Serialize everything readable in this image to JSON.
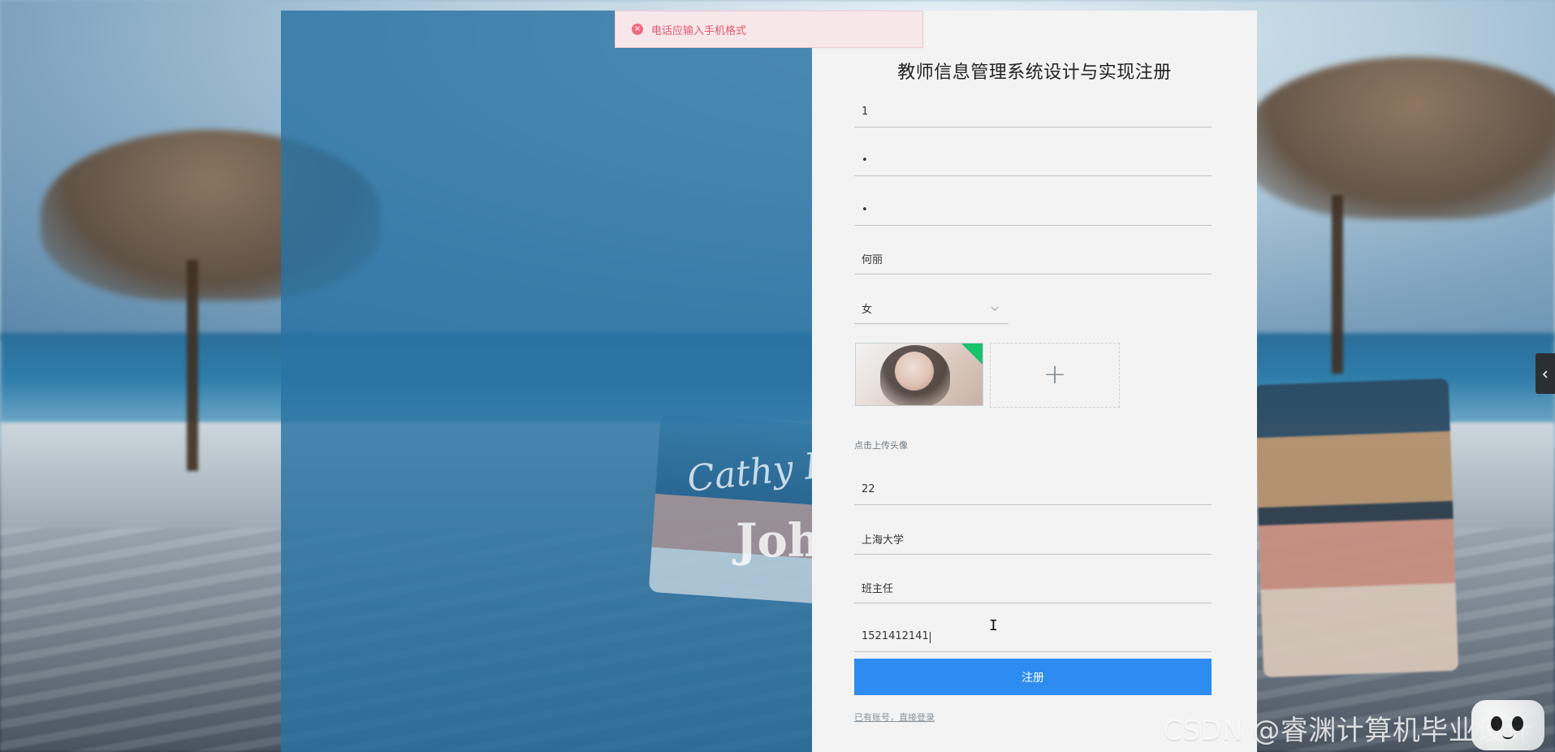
{
  "toast": {
    "message": "电话应输入手机格式"
  },
  "register": {
    "title": "教师信息管理系统设计与实现注册",
    "fields": [
      {
        "name": "account",
        "value": "1"
      },
      {
        "name": "password",
        "value": "•"
      },
      {
        "name": "confirm-password",
        "value": "•"
      },
      {
        "name": "name",
        "value": "何丽"
      },
      {
        "name": "age",
        "value": "22"
      },
      {
        "name": "school",
        "value": "上海大学"
      },
      {
        "name": "position",
        "value": "班主任"
      },
      {
        "name": "phone",
        "value": "1521412141"
      }
    ],
    "gender": {
      "selected": "女"
    },
    "upload": {
      "hint": "点击上传头像"
    },
    "submit_label": "注册",
    "login_link": "已有账号，直接登录"
  },
  "watermark": "CSDN @睿渊计算机毕业设计",
  "icons": {
    "toast_icon": "error-circle-icon",
    "chevron": "chevron-down-icon",
    "plus": "plus-icon",
    "side_arrow": "chevron-left-icon",
    "cursor": "text-cursor-icon"
  },
  "colors": {
    "primary": "#2d8cf0",
    "toast_bg": "#f7e7ea",
    "toast_text": "#e05a6b",
    "panel_bg": "#f3f3f3",
    "overlay_blue": "#2a73a4",
    "avatar_corner": "#19c26b"
  }
}
